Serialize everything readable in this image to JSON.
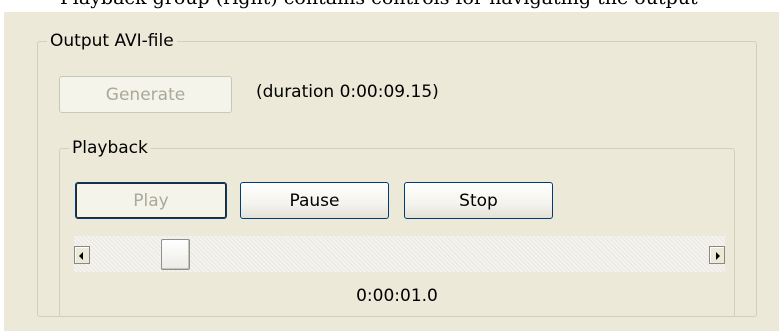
{
  "document": {
    "top_caption_fragment": "Playback group (right) contains controls for navigating the output"
  },
  "output_group": {
    "title": "Output AVI-file",
    "generate_label": "Generate",
    "duration_text": "(duration 0:00:09.15)"
  },
  "playback_group": {
    "title": "Playback",
    "play_label": "Play",
    "pause_label": "Pause",
    "stop_label": "Stop",
    "slider": {
      "position_fraction": 0.12
    },
    "time_label": "0:00:01.0"
  },
  "colors": {
    "panel_background": "#ece9d8",
    "group_border": "#d0d0bf",
    "button_border": "#003c74",
    "disabled_text": "#aca899"
  },
  "icons": {
    "scroll_left": "triangle-left",
    "scroll_right": "triangle-right"
  }
}
